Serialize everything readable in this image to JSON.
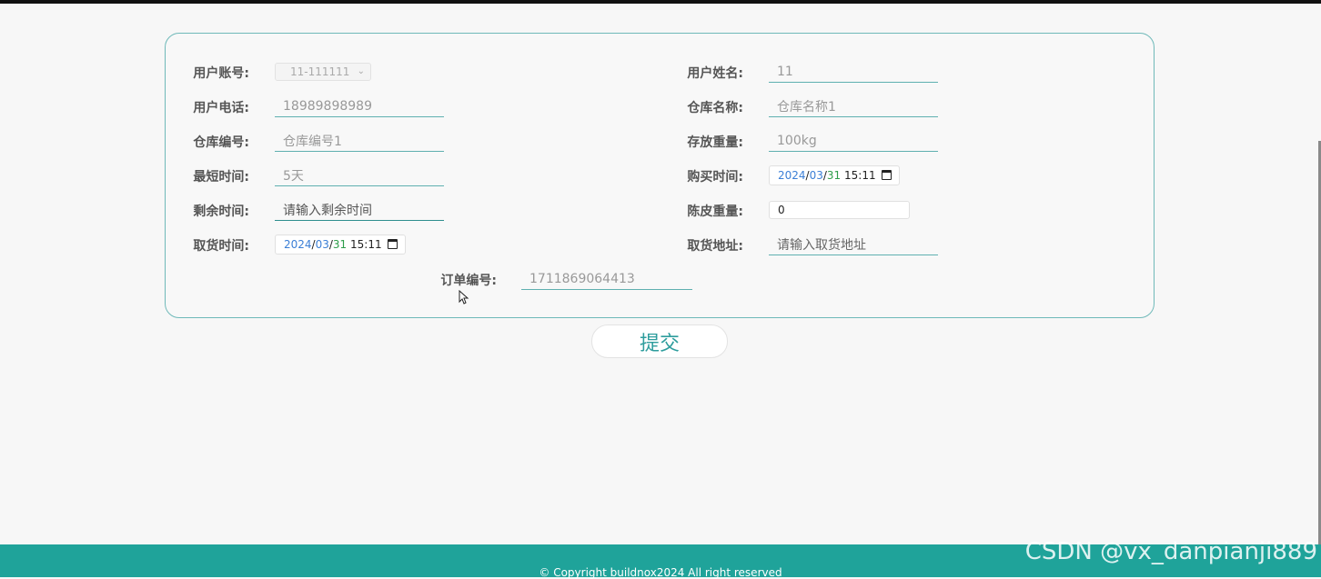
{
  "form": {
    "user_account_label": "用户账号:",
    "user_account_value": "11-111111",
    "user_name_label": "用户姓名:",
    "user_name_value": "11",
    "user_phone_label": "用户电话:",
    "user_phone_value": "18989898989",
    "warehouse_name_label": "仓库名称:",
    "warehouse_name_placeholder": "仓库名称1",
    "warehouse_no_label": "仓库编号:",
    "warehouse_no_placeholder": "仓库编号1",
    "storage_weight_label": "存放重量:",
    "storage_weight_value": "100kg",
    "min_time_label": "最短时间:",
    "min_time_value": "5天",
    "purchase_time_label": "购买时间:",
    "purchase_time": {
      "year": "2024",
      "month": "03",
      "day": "31",
      "time": "15:11"
    },
    "remaining_time_label": "剩余时间:",
    "remaining_time_placeholder": "请输入剩余时间",
    "tare_weight_label": "陈皮重量:",
    "tare_weight_value": "0",
    "pickup_time_label": "取货时间:",
    "pickup_time": {
      "year": "2024",
      "month": "03",
      "day": "31",
      "time": "15:11"
    },
    "pickup_address_label": "取货地址:",
    "pickup_address_placeholder": "请输入取货地址",
    "order_no_label": "订单编号:",
    "order_no_value": "1711869064413"
  },
  "submit_label": "提交",
  "footer_text": "© Copyright buildnox2024   All right reserved",
  "watermark": "CSDN @vx_danpianji889",
  "colors": {
    "accent": "#2e9d9d",
    "footer": "#1fa39a",
    "border": "#6fb9b9"
  }
}
